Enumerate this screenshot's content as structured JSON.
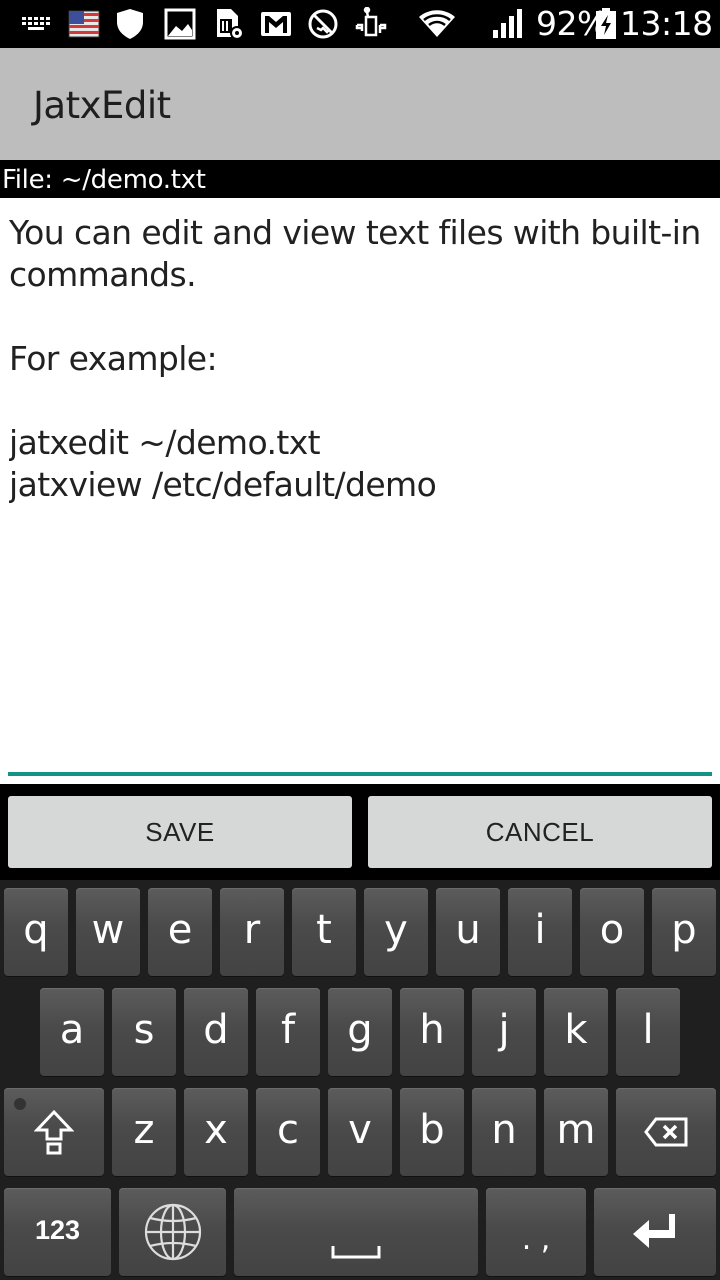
{
  "status_bar": {
    "icons": [
      "keyboard-icon",
      "us-flag-icon",
      "shield-icon",
      "image-icon",
      "sim-settings-icon",
      "gmail-icon",
      "call-blocked-icon",
      "android-debug-icon",
      "wifi-icon",
      "signal-icon",
      "battery-charging-icon"
    ],
    "battery_percent": "92%",
    "time": "13:18"
  },
  "app_bar": {
    "title": "JatxEdit"
  },
  "file_bar": {
    "label": "File: ~/demo.txt"
  },
  "editor": {
    "content": "You can edit and view text files with built-in commands.\n\nFor example:\n\njatxedit ~/demo.txt\njatxview /etc/default/demo",
    "accent_color": "#139386"
  },
  "actions": {
    "save_label": "SAVE",
    "cancel_label": "CANCEL"
  },
  "keyboard": {
    "row1": [
      "q",
      "w",
      "e",
      "r",
      "t",
      "y",
      "u",
      "i",
      "o",
      "p"
    ],
    "row2": [
      "a",
      "s",
      "d",
      "f",
      "g",
      "h",
      "j",
      "k",
      "l"
    ],
    "row3": [
      "z",
      "x",
      "c",
      "v",
      "b",
      "n",
      "m"
    ],
    "numbers_label": "123",
    "punctuation_label": ". ,",
    "icons": {
      "shift": "shift-icon",
      "backspace": "backspace-icon",
      "language": "globe-icon",
      "space": "space-icon",
      "enter": "enter-icon"
    }
  }
}
